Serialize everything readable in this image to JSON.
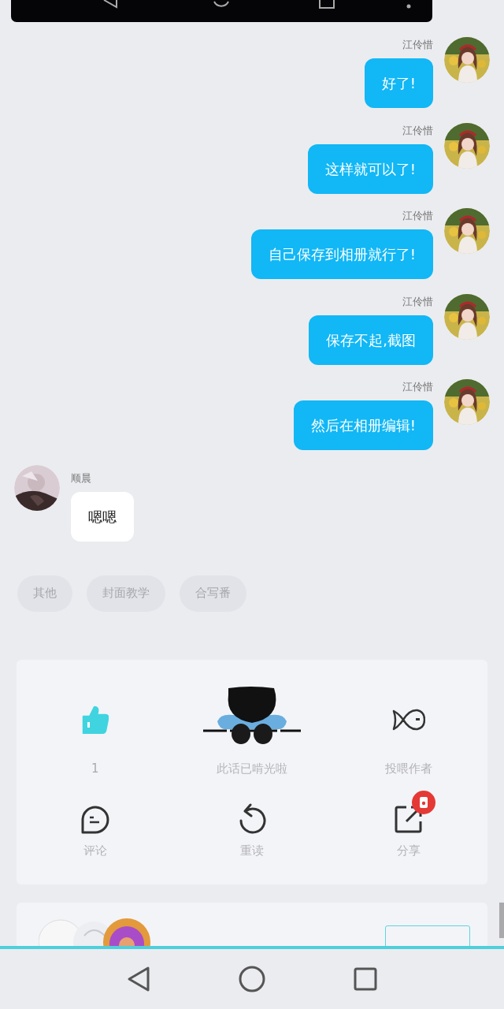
{
  "messages": [
    {
      "kind": "outgoing",
      "sender": "江伶惜",
      "text": "好了!"
    },
    {
      "kind": "outgoing",
      "sender": "江伶惜",
      "text": "这样就可以了!"
    },
    {
      "kind": "outgoing",
      "sender": "江伶惜",
      "text": "自己保存到相册就行了!"
    },
    {
      "kind": "outgoing",
      "sender": "江伶惜",
      "text": "保存不起,截图"
    },
    {
      "kind": "outgoing",
      "sender": "江伶惜",
      "text": "然后在相册编辑!"
    },
    {
      "kind": "incoming",
      "sender": "顺晨",
      "text": "嗯嗯"
    }
  ],
  "tags": [
    "其他",
    "封面教学",
    "合写番"
  ],
  "actions": [
    {
      "kind": "like",
      "label": "1",
      "selected": true
    },
    {
      "kind": "mascot",
      "label": "此话已啃光啦"
    },
    {
      "kind": "feed",
      "label": "投喂作者"
    },
    {
      "kind": "comment",
      "label": "评论"
    },
    {
      "kind": "reread",
      "label": "重读"
    },
    {
      "kind": "share",
      "label": "分享",
      "badge": true
    }
  ]
}
